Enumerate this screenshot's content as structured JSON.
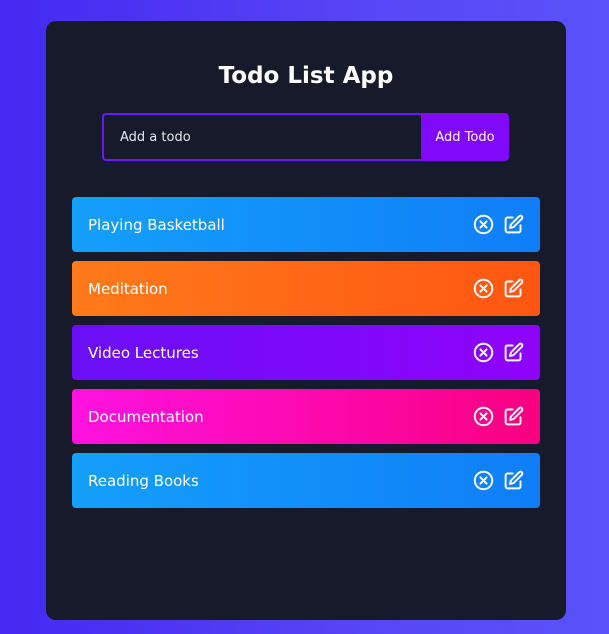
{
  "app": {
    "title": "Todo List App"
  },
  "form": {
    "placeholder": "Add a todo",
    "value": "",
    "button_label": "Add Todo"
  },
  "todos": [
    {
      "text": "Playing Basketball",
      "color": "#149ffa"
    },
    {
      "text": "Meditation",
      "color": "#ff7a1a"
    },
    {
      "text": "Video Lectures",
      "color": "#6a0ff5"
    },
    {
      "text": "Documentation",
      "color": "#ff12e0"
    },
    {
      "text": "Reading Books",
      "color": "#149ffa"
    }
  ],
  "icons": {
    "delete": "close-circle-icon",
    "edit": "edit-icon"
  },
  "colors": {
    "background": "#4528f2",
    "card": "#161a2b",
    "accent": "#8009fb"
  }
}
